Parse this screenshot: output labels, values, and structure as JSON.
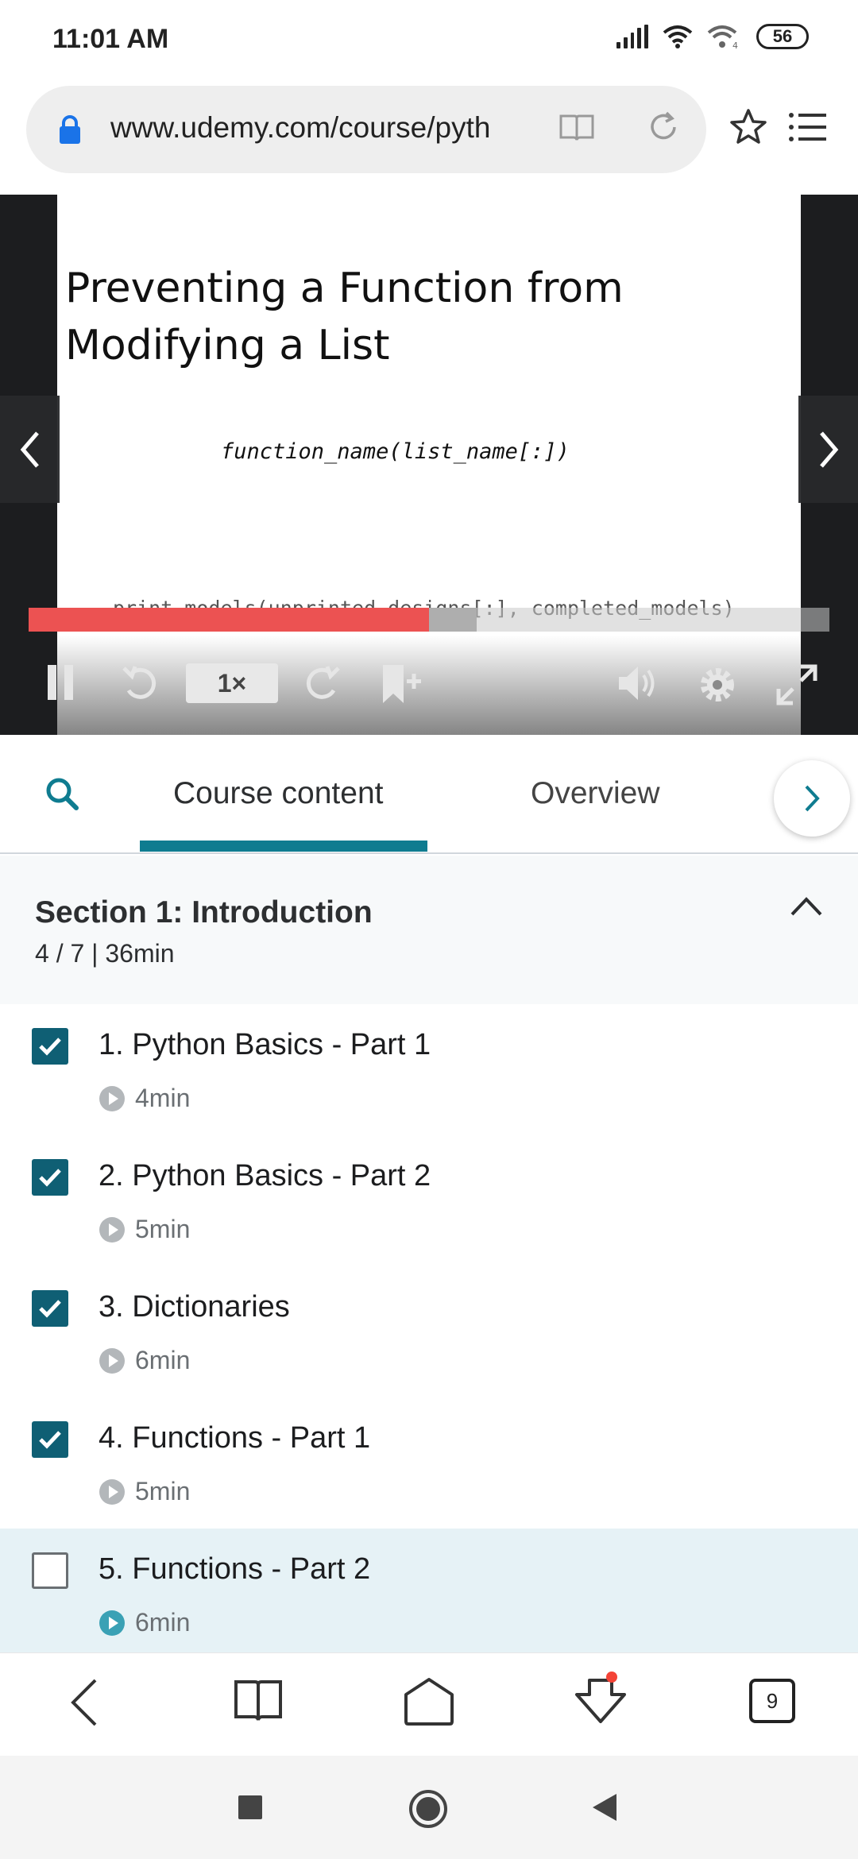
{
  "status_bar": {
    "time": "11:01 AM",
    "battery": "56"
  },
  "browser": {
    "url": "www.udemy.com/course/pyth"
  },
  "video": {
    "slide_title": "Preventing a Function from Modifying a List",
    "code_line_1": "function_name(list_name[:])",
    "code_line_2": "print_models(unprinted_designs[:], completed_models)",
    "progress_fraction": 0.5,
    "buffered_fraction": 0.56,
    "speed": "1×"
  },
  "tabs": [
    {
      "label": "Course content",
      "active": true
    },
    {
      "label": "Overview",
      "active": false
    }
  ],
  "section": {
    "title": "Section 1: Introduction",
    "meta": "4 / 7 | 36min"
  },
  "lectures": [
    {
      "title": "1. Python Basics - Part 1",
      "duration": "4min",
      "completed": true
    },
    {
      "title": "2. Python Basics - Part 2",
      "duration": "5min",
      "completed": true
    },
    {
      "title": "3. Dictionaries",
      "duration": "6min",
      "completed": true
    },
    {
      "title": "4. Functions - Part 1",
      "duration": "5min",
      "completed": true
    },
    {
      "title": "5. Functions - Part 2",
      "duration": "6min",
      "completed": false,
      "current": true
    }
  ],
  "browser_nav": {
    "tab_count": "9"
  },
  "colors": {
    "accent": "#0f7c90",
    "progress": "#ec5252",
    "checkbox": "#0f5f74"
  }
}
